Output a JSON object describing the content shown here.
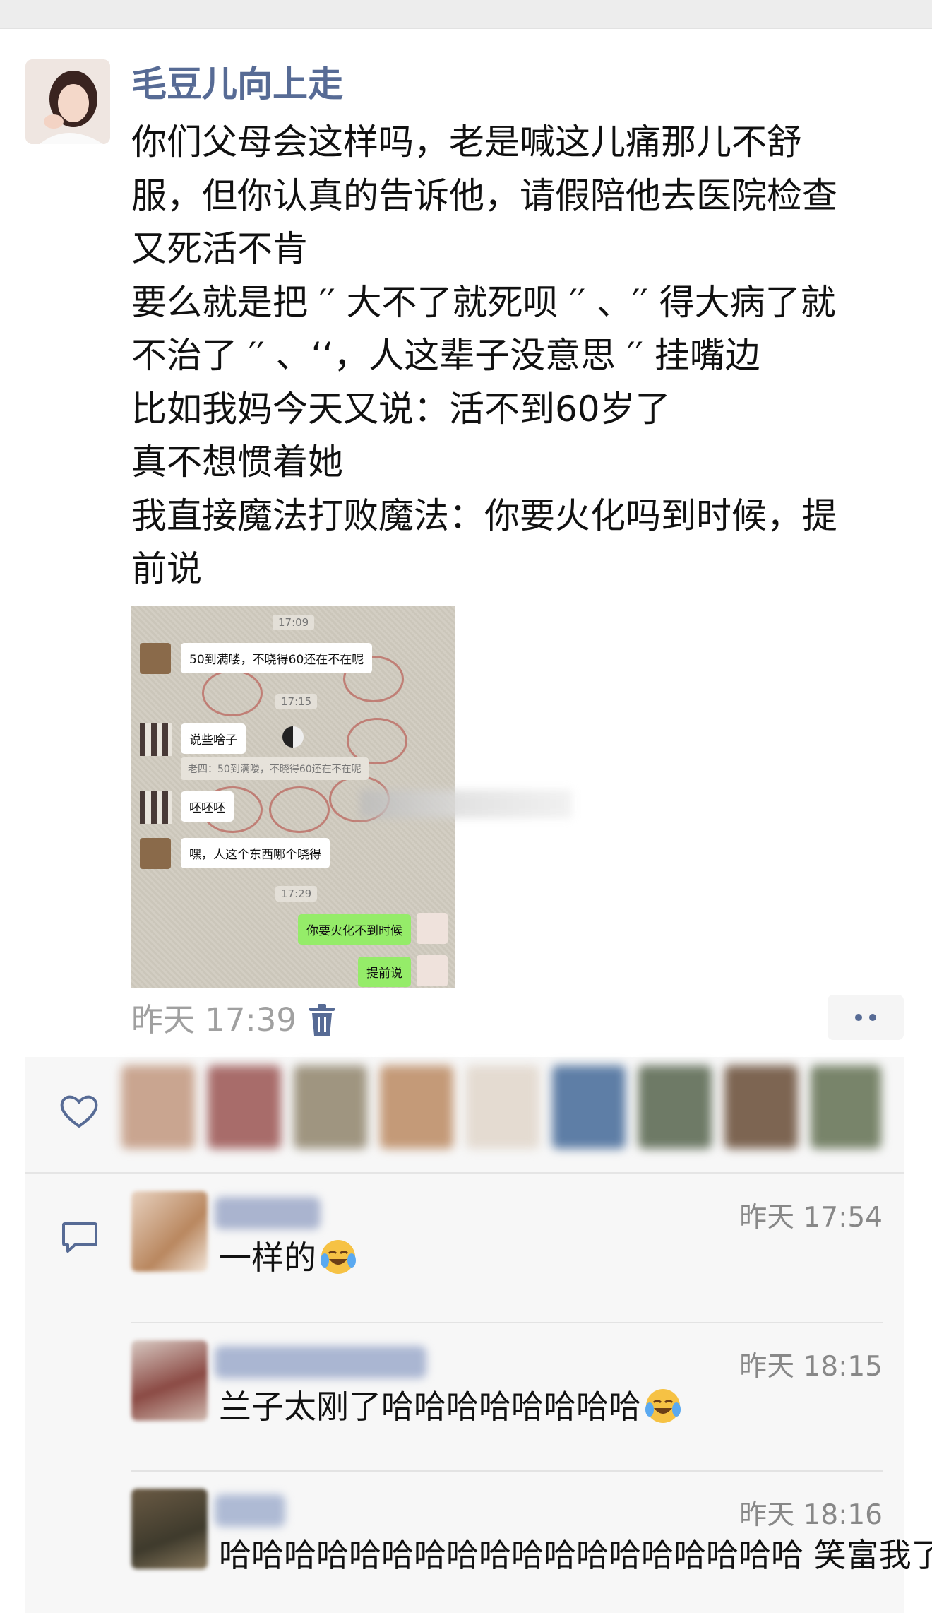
{
  "post": {
    "username": "毛豆儿向上走",
    "lines": [
      "你们父母会这样吗，老是喊这儿痛那儿不舒",
      "服，但你认真的告诉他，请假陪他去医院检查",
      "又死活不肯",
      "要么就是把 ′′ 大不了就死呗 ′′ 、′′ 得大病了就",
      "不治了 ′′ 、‘‘，人这辈子没意思 ′′ 挂嘴边",
      "比如我妈今天又说：活不到60岁了",
      "真不想惯着她",
      "我直接魔法打败魔法：你要火化吗到时候，提",
      "前说"
    ],
    "time": "昨天 17:39"
  },
  "screenshot": {
    "time1": "17:09",
    "msg1": "50到满喽，不晓得60还在不在呢",
    "time2": "17:15",
    "msg2": "说些啥子",
    "quote": "老四：50到满喽，不晓得60还在不在呢",
    "msg3": "呸呸呸",
    "msg4": "嘿，人这个东西哪个晓得",
    "time3": "17:29",
    "msg5": "你要火化不到时候",
    "msg6": "提前说"
  },
  "comments": [
    {
      "time": "昨天 17:54",
      "text": "一样的"
    },
    {
      "time": "昨天 18:15",
      "text": "兰子太刚了哈哈哈哈哈哈哈哈"
    },
    {
      "time": "昨天 18:16",
      "text": "哈哈哈哈哈哈哈哈哈哈哈哈哈哈哈哈哈哈 笑富我了"
    }
  ],
  "colors": {
    "name": "#576b95",
    "wechat_green": "#95ec69",
    "muted": "#a0a0a0"
  },
  "icons": [
    "trash-icon",
    "heart-icon",
    "comment-icon",
    "more-icon",
    "laughing-crying-emoji"
  ]
}
